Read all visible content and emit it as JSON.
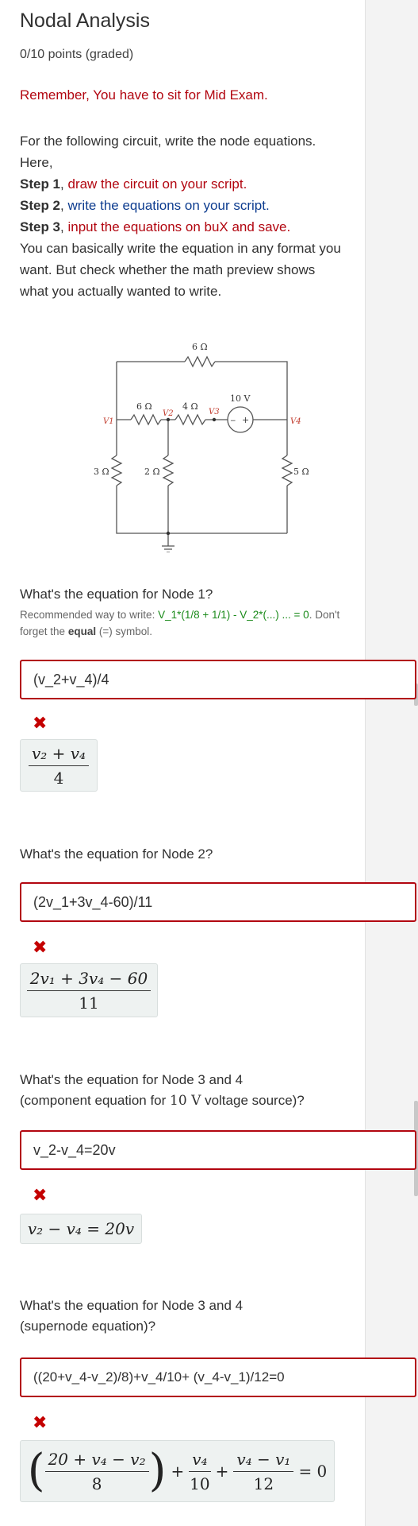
{
  "page": {
    "title": "Nodal Analysis",
    "points": "0/10 points (graded)",
    "reminder": "Remember, You have to sit for Mid Exam."
  },
  "intro": {
    "line1": "For the following circuit, write the node equations. Here,",
    "step1_label": "Step 1",
    "step1_text": "draw the circuit on your script.",
    "step2_label": "Step 2",
    "step2_text": "write the equations on your script.",
    "step3_label": "Step 3",
    "step3_text": "input the equations on buX and save.",
    "closing": "You can basically write the equation in any format you want. But check whether the math preview shows what you actually wanted to write."
  },
  "circuit": {
    "r_top": "6 Ω",
    "r_left_mid": "6 Ω",
    "r_mid": "4 Ω",
    "source": "10 V",
    "r_left": "3 Ω",
    "r_center": "2 Ω",
    "r_right": "5 Ω",
    "v1": "V1",
    "v2": "V2",
    "v3": "V3",
    "v4": "V4",
    "plus": "+",
    "minus": "−"
  },
  "questions": [
    {
      "prompt": "What's the equation for Node 1?",
      "hint_prefix": "Recommended way to write:",
      "hint_example": "V_1*(1/8 + 1/1) - V_2*(...) ... = 0",
      "hint_middle": ". Don't forget the",
      "hint_bold": "equal",
      "hint_symbol": "(=)",
      "hint_suffix": "symbol.",
      "answer": "(v_2+v_4)/4",
      "status": "incorrect",
      "preview_num": "v₂ + v₄",
      "preview_den": "4"
    },
    {
      "prompt": "What's the equation for Node 2?",
      "answer": "(2v_1+3v_4-60)/11",
      "status": "incorrect",
      "preview_num": "2v₁ + 3v₄ − 60",
      "preview_den": "11"
    },
    {
      "prompt_line1": "What's the equation for Node 3 and 4",
      "prompt_line2_pre": "(component equation for",
      "prompt_line2_math": "10 V",
      "prompt_line2_post": "voltage source)?",
      "answer": "v_2-v_4=20v",
      "status": "incorrect",
      "preview": "v₂ − v₄ = 20v"
    },
    {
      "prompt_line1": "What's the equation for Node 3 and 4",
      "prompt_line2": "(supernode equation)?",
      "answer": "((20+v_4-v_2)/8)+v_4/10+ (v_4-v_1)/12=0",
      "status": "incorrect",
      "preview_f1_num": "20 + v₄ − v₂",
      "preview_f1_den": "8",
      "preview_f2_num": "v₄",
      "preview_f2_den": "10",
      "preview_f3_num": "v₄ − v₁",
      "preview_f3_den": "12",
      "preview_rhs": "= 0"
    }
  ],
  "icons": {
    "incorrect": "✖"
  }
}
